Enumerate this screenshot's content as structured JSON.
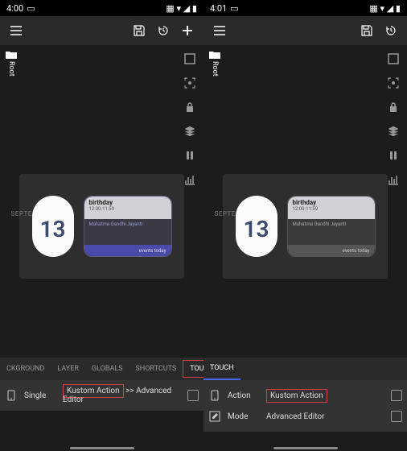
{
  "panes": [
    {
      "status": {
        "time": "4:00"
      },
      "sidebar_label": "Root",
      "widget": {
        "month": "SEPTEMBER",
        "date": "13",
        "event1_title": "birthday",
        "event1_time": "12:00-11:59",
        "event2_title": "Mahatma Gandhi Jayanti",
        "footer": "events today"
      },
      "tabs": [
        "CKGROUND",
        "LAYER",
        "GLOBALS",
        "SHORTCUTS",
        "TOUCH"
      ],
      "active_tab": 4,
      "highlight_tab": 4,
      "props": [
        {
          "label": "Single",
          "value": "Kustom Action >> Advanced Editor",
          "highlight_value": "Kustom Action",
          "rest_value": " >> Advanced Editor"
        }
      ]
    },
    {
      "status": {
        "time": "4:01"
      },
      "sidebar_label": "Root",
      "widget": {
        "month": "SEPTEMBER",
        "date": "13",
        "event1_title": "birthday",
        "event1_time": "12:00-11:59",
        "event2_title": "Mahatma Gandhi Jayanti",
        "footer": "events today"
      },
      "tabs": [
        "TOUCH"
      ],
      "active_tab": 0,
      "props": [
        {
          "label": "Action",
          "value": "Kustom Action",
          "highlight_full": true
        },
        {
          "label": "Mode",
          "value": "Advanced Editor"
        }
      ]
    }
  ]
}
